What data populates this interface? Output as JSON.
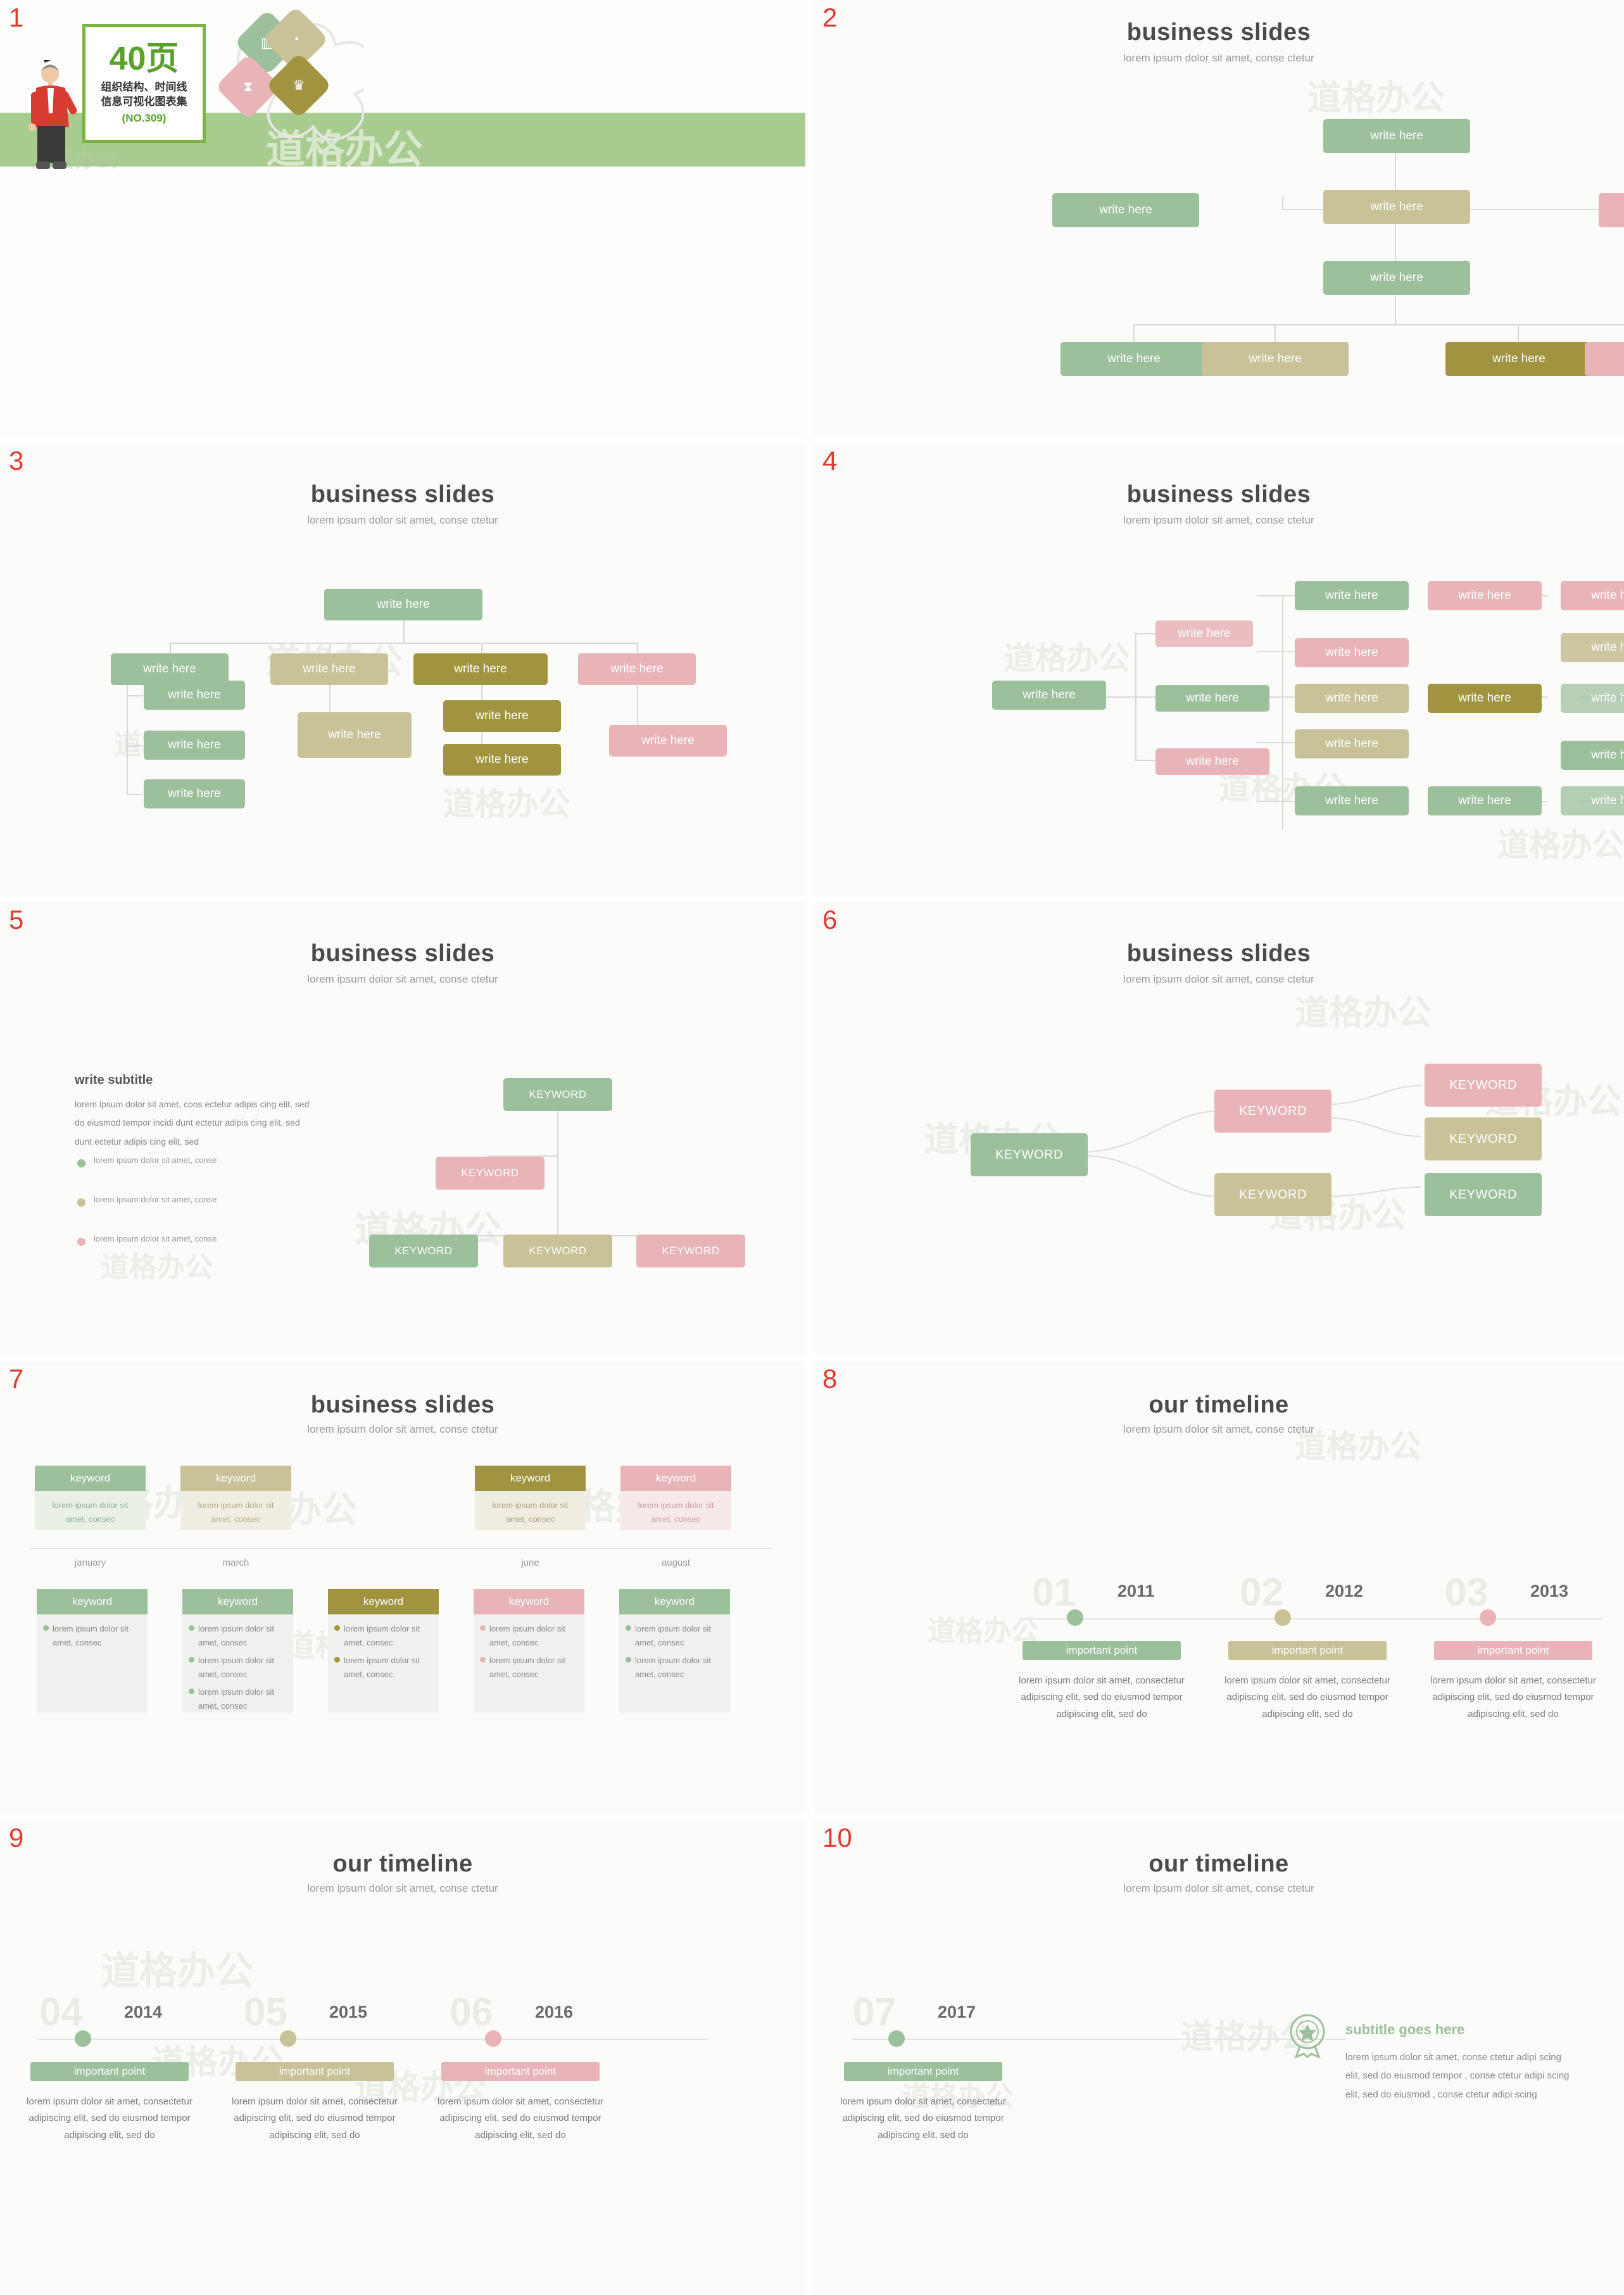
{
  "common": {
    "title": "business slides",
    "subtitle": "lorem ipsum dolor sit amet, conse ctetur",
    "timeline_title": "our timeline",
    "write_here": "write here",
    "keyword": "KEYWORD",
    "keyword_lc": "keyword",
    "important_point": "important point",
    "watermark": "道格办公",
    "colors": {
      "green": "#9cbf9c",
      "khaki": "#c9c198",
      "pink": "#e8b4b8",
      "dark_khaki": "#a09440",
      "red_number": "#e03a32",
      "band_green": "#a8cc8f"
    }
  },
  "slides": [
    {
      "number": "1",
      "cover": {
        "big_number": "40页",
        "line1": "组织结构、时间线",
        "line2": "信息可视化图表集",
        "code": "(NO.309)",
        "icons": [
          "chart-icon",
          "pie-icon",
          "hourglass-icon",
          "trophy-icon"
        ]
      }
    },
    {
      "number": "2",
      "title": "business slides",
      "subtitle": "lorem ipsum dolor sit amet, conse ctetur",
      "nodes": [
        {
          "label": "write here",
          "color": "green"
        },
        {
          "label": "write here",
          "color": "green"
        },
        {
          "label": "write here",
          "color": "khaki"
        },
        {
          "label": "write here",
          "color": "pink"
        },
        {
          "label": "write here",
          "color": "green"
        },
        {
          "label": "write here",
          "color": "green"
        },
        {
          "label": "write here",
          "color": "khaki"
        },
        {
          "label": "write here",
          "color": "dark"
        },
        {
          "label": "write here",
          "color": "pink"
        }
      ]
    },
    {
      "number": "3",
      "title": "business slides",
      "subtitle": "lorem ipsum dolor sit amet, conse ctetur",
      "nodes": [
        {
          "label": "write here",
          "color": "green"
        },
        {
          "label": "write here",
          "color": "green"
        },
        {
          "label": "write here",
          "color": "khaki"
        },
        {
          "label": "write here",
          "color": "dark"
        },
        {
          "label": "write here",
          "color": "pink"
        },
        {
          "label": "write here",
          "color": "green"
        },
        {
          "label": "write here",
          "color": "green"
        },
        {
          "label": "write here",
          "color": "green"
        },
        {
          "label": "write here",
          "color": "khaki"
        },
        {
          "label": "write here",
          "color": "dark"
        },
        {
          "label": "write here",
          "color": "dark"
        },
        {
          "label": "write here",
          "color": "pink"
        }
      ]
    },
    {
      "number": "4",
      "title": "business slides",
      "subtitle": "lorem ipsum dolor sit amet, conse ctetur",
      "nodes": [
        {
          "label": "write here",
          "color": "green"
        },
        {
          "label": "write here",
          "color": "pink"
        },
        {
          "label": "write here",
          "color": "green"
        },
        {
          "label": "write here",
          "color": "pink"
        },
        {
          "label": "write here",
          "color": "green"
        },
        {
          "label": "write here",
          "color": "pink"
        },
        {
          "label": "write here",
          "color": "pink"
        },
        {
          "label": "write here",
          "color": "dark"
        },
        {
          "label": "write here",
          "color": "khaki"
        },
        {
          "label": "write here",
          "color": "dark"
        },
        {
          "label": "write here",
          "color": "khaki"
        },
        {
          "label": "write here",
          "color": "green"
        },
        {
          "label": "write here",
          "color": "green"
        },
        {
          "label": "write here",
          "color": "khaki"
        },
        {
          "label": "write here",
          "color": "green"
        },
        {
          "label": "write here",
          "color": "green"
        },
        {
          "label": "write here",
          "color": "green"
        }
      ]
    },
    {
      "number": "5",
      "title": "business slides",
      "subtitle": "lorem ipsum dolor sit amet, conse ctetur",
      "side_title": "write subtitle",
      "side_body": "lorem ipsum dolor sit amet, cons ectetur adipis cing elit, sed do eiusmod tempor incidi dunt ectetur adipis cing elit, sed dunt ectetur adipis cing elit, sed",
      "legend": [
        {
          "text": "lorem ipsum dolor sit amet, conse",
          "color": "green"
        },
        {
          "text": "lorem ipsum dolor sit amet, conse",
          "color": "khaki"
        },
        {
          "text": "lorem ipsum dolor sit amet, conse",
          "color": "pink"
        }
      ],
      "nodes": [
        {
          "label": "KEYWORD",
          "color": "green"
        },
        {
          "label": "KEYWORD",
          "color": "pink"
        },
        {
          "label": "KEYWORD",
          "color": "green"
        },
        {
          "label": "KEYWORD",
          "color": "khaki"
        },
        {
          "label": "KEYWORD",
          "color": "pink"
        }
      ]
    },
    {
      "number": "6",
      "title": "business slides",
      "subtitle": "lorem ipsum dolor sit amet, conse ctetur",
      "nodes": [
        {
          "label": "KEYWORD",
          "color": "green"
        },
        {
          "label": "KEYWORD",
          "color": "pink"
        },
        {
          "label": "KEYWORD",
          "color": "khaki"
        },
        {
          "label": "KEYWORD",
          "color": "pink"
        },
        {
          "label": "KEYWORD",
          "color": "khaki"
        },
        {
          "label": "KEYWORD",
          "color": "green"
        }
      ]
    },
    {
      "number": "7",
      "title": "business slides",
      "subtitle": "lorem ipsum dolor sit amet, conse ctetur",
      "top_cards": [
        {
          "label": "keyword",
          "body": "lorem ipsum dolor sit amet, consec",
          "month": "january",
          "color": "green"
        },
        {
          "label": "keyword",
          "body": "lorem ipsum dolor sit amet, consec",
          "month": "march",
          "color": "khaki"
        },
        {
          "label": "keyword",
          "body": "lorem ipsum dolor sit amet, consec",
          "month": "june",
          "color": "dark"
        },
        {
          "label": "keyword",
          "body": "lorem ipsum dolor sit amet, consec",
          "month": "august",
          "color": "pink"
        }
      ],
      "bottom_cards": [
        {
          "label": "keyword",
          "color": "green",
          "items": [
            "lorem ipsum dolor sit amet, consec"
          ]
        },
        {
          "label": "keyword",
          "color": "green",
          "items": [
            "lorem ipsum dolor sit amet, consec",
            "lorem ipsum dolor sit amet, consec",
            "lorem ipsum dolor sit amet, consec"
          ]
        },
        {
          "label": "keyword",
          "color": "dark",
          "items": [
            "lorem ipsum dolor sit amet, consec",
            "lorem ipsum dolor sit amet, consec"
          ]
        },
        {
          "label": "keyword",
          "color": "pink",
          "items": [
            "lorem ipsum dolor sit amet, consec",
            "lorem ipsum dolor sit amet, consec"
          ]
        },
        {
          "label": "keyword",
          "color": "green",
          "items": [
            "lorem ipsum dolor sit amet, consec",
            "lorem ipsum dolor sit amet, consec"
          ]
        }
      ]
    },
    {
      "number": "8",
      "title": "our timeline",
      "subtitle": "lorem ipsum dolor sit amet, conse ctetur",
      "items": [
        {
          "index": "01",
          "year": "2011",
          "label": "important point",
          "body": "lorem ipsum dolor sit amet, consectetur adipiscing elit, sed do eiusmod tempor adipiscing elit, sed do",
          "color": "green"
        },
        {
          "index": "02",
          "year": "2012",
          "label": "important point",
          "body": "lorem ipsum dolor sit amet, consectetur adipiscing elit, sed do eiusmod tempor adipiscing elit, sed do",
          "color": "khaki"
        },
        {
          "index": "03",
          "year": "2013",
          "label": "important point",
          "body": "lorem ipsum dolor sit amet, consectetur adipiscing elit, sed do eiusmod tempor adipiscing elit, sed do",
          "color": "pink"
        }
      ]
    },
    {
      "number": "9",
      "title": "our timeline",
      "subtitle": "lorem ipsum dolor sit amet, conse ctetur",
      "items": [
        {
          "index": "04",
          "year": "2014",
          "label": "important point",
          "body": "lorem ipsum dolor sit amet, consectetur adipiscing elit, sed do eiusmod tempor adipiscing elit, sed do",
          "color": "green"
        },
        {
          "index": "05",
          "year": "2015",
          "label": "important point",
          "body": "lorem ipsum dolor sit amet, consectetur adipiscing elit, sed do eiusmod tempor adipiscing elit, sed do",
          "color": "khaki"
        },
        {
          "index": "06",
          "year": "2016",
          "label": "important point",
          "body": "lorem ipsum dolor sit amet, consectetur adipiscing elit, sed do eiusmod tempor adipiscing elit, sed do",
          "color": "pink"
        }
      ]
    },
    {
      "number": "10",
      "title": "our timeline",
      "subtitle": "lorem ipsum dolor sit amet, conse ctetur",
      "items": [
        {
          "index": "07",
          "year": "2017",
          "label": "important point",
          "body": "lorem ipsum dolor sit amet, consectetur adipiscing elit, sed do eiusmod tempor adipiscing elit, sed do",
          "color": "green"
        }
      ],
      "side_title": "subtitle goes here",
      "side_body": "lorem ipsum dolor sit amet, conse ctetur adipi scing elit, sed do eiusmod tempor , conse ctetur adipi scing elit, sed do eiusmod , conse ctetur adipi scing",
      "badge_icon": "medal-icon"
    }
  ]
}
